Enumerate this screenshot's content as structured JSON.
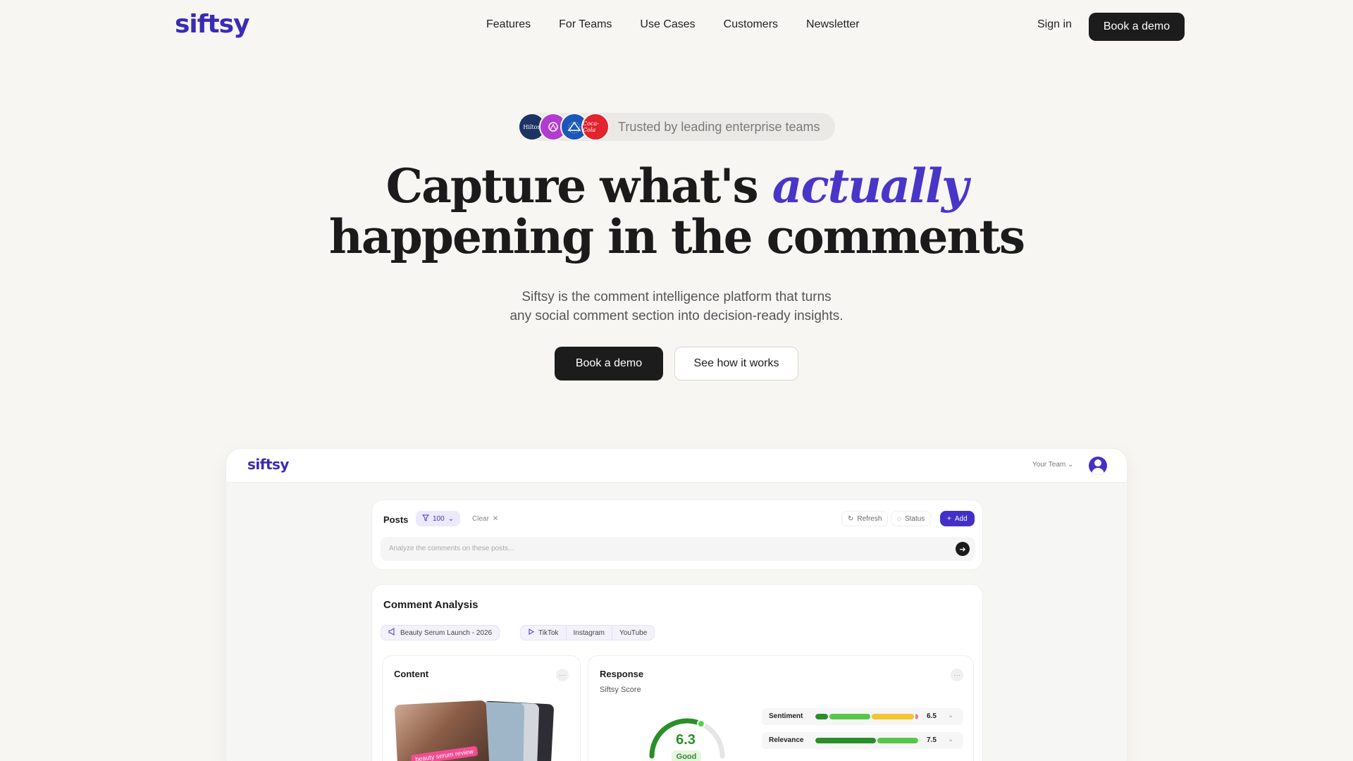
{
  "nav": {
    "logo": "siftsy",
    "links": [
      "Features",
      "For Teams",
      "Use Cases",
      "Customers",
      "Newsletter"
    ],
    "sign_in": "Sign in",
    "book_demo": "Book a demo"
  },
  "hero": {
    "trusted_text": "Trusted by leading enterprise teams",
    "trusted_logos": [
      "Hilton",
      "",
      "",
      "Coca-Cola"
    ],
    "headline_part1": "Capture what's ",
    "headline_emph": "actually",
    "headline_line2": "happening in the comments",
    "sub_line1": "Siftsy is the comment intelligence platform that turns",
    "sub_line2": "any social comment section into decision-ready insights.",
    "cta_primary": "Book a demo",
    "cta_secondary": "See how it works"
  },
  "app": {
    "logo": "siftsy",
    "team": "Your Team",
    "posts": {
      "title": "Posts",
      "filter_count": "100",
      "clear": "Clear",
      "refresh": "Refresh",
      "status": "Status",
      "add": "Add",
      "analyze_placeholder": "Analyze the comments on these posts..."
    },
    "analysis": {
      "title": "Comment Analysis",
      "campaign": "Beauty Serum Launch - 2026",
      "platforms": [
        "TikTok",
        "Instagram",
        "YouTube"
      ],
      "content_title": "Content",
      "thumb_tag": "beauty serum review",
      "response_title": "Response",
      "score_label": "Siftsy Score",
      "score_value": "6.3",
      "score_fraction": 0.63,
      "score_rating": "Good",
      "metrics": [
        {
          "name": "Sentiment",
          "value": "6.5"
        },
        {
          "name": "Relevance",
          "value": "7.5"
        }
      ]
    }
  },
  "colors": {
    "brand": "#4331c7",
    "dark": "#1c1c1c",
    "good": "#2a8f2a"
  }
}
